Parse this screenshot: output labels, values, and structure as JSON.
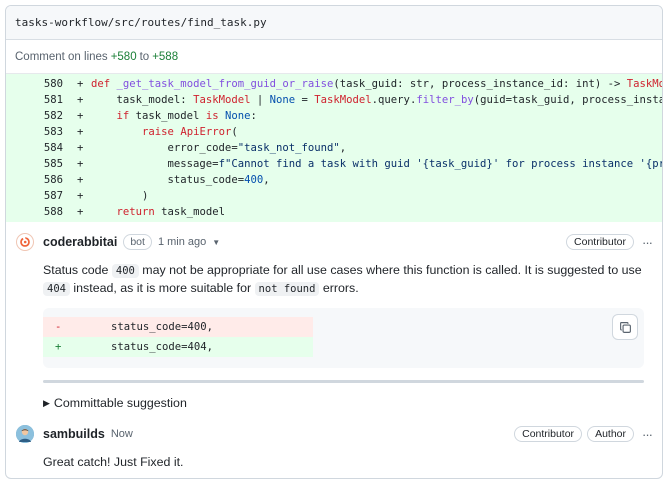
{
  "file": {
    "path": "tasks-workflow/src/routes/find_task.py"
  },
  "comment_range": {
    "prefix": "Comment on lines",
    "start": "+580",
    "middle": "to",
    "end": "+588"
  },
  "diff_lines": [
    {
      "num": "580",
      "sign": "+",
      "code": "def _get_task_model_from_guid_or_raise(task_guid: str, process_instance_id: int) -> TaskModel:"
    },
    {
      "num": "581",
      "sign": "+",
      "code": "    task_model: TaskModel | None = TaskModel.query.filter_by(guid=task_guid, process_instance_id=process_instance_id).first()"
    },
    {
      "num": "582",
      "sign": "+",
      "code": "    if task_model is None:"
    },
    {
      "num": "583",
      "sign": "+",
      "code": "        raise ApiError("
    },
    {
      "num": "584",
      "sign": "+",
      "code": "            error_code=\"task_not_found\","
    },
    {
      "num": "585",
      "sign": "+",
      "code": "            message=f\"Cannot find a task with guid '{task_guid}' for process instance '{process_instance_id}'\","
    },
    {
      "num": "586",
      "sign": "+",
      "code": "            status_code=400,"
    },
    {
      "num": "587",
      "sign": "+",
      "code": "        )"
    },
    {
      "num": "588",
      "sign": "+",
      "code": "    return task_model"
    }
  ],
  "comments": [
    {
      "author": "coderabbitai",
      "bot_label": "bot",
      "time": "1 min ago",
      "role": "Contributor",
      "body_parts": [
        "Status code ",
        "400",
        " may not be appropriate for all use cases where this function is called. It is suggested to use ",
        "404",
        " instead, as it is more suitable for ",
        "not found",
        " errors."
      ],
      "suggestion": {
        "del": {
          "sign": "-",
          "code": "status_code=400,"
        },
        "ins": {
          "sign": "+",
          "code": "status_code=404,"
        }
      },
      "committable_label": "Committable suggestion"
    },
    {
      "author": "sambuilds",
      "time": "Now",
      "roles": [
        "Contributor",
        "Author"
      ],
      "body": "Great catch! Just Fixed it."
    }
  ],
  "icons": {
    "rabbit_avatar": "coderabbit-logo-icon",
    "user_avatar": "user-avatar-icon",
    "copy": "copy-icon",
    "more": "kebab-icon",
    "caret": "chevron-down-icon",
    "disclosure": "triangle-right-icon"
  },
  "colors": {
    "added_bg": "#e6ffec",
    "deleted_bg": "#ffebe9",
    "keyword": "#cf222e",
    "entity": "#8250df",
    "constant": "#0550ae"
  }
}
